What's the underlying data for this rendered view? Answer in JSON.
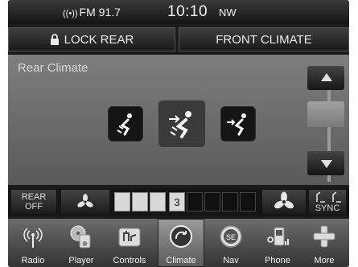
{
  "status": {
    "station": "FM 91.7",
    "time": "10:10",
    "heading": "NW"
  },
  "top_buttons": {
    "lock_rear": "LOCK REAR",
    "front_climate": "FRONT CLIMATE"
  },
  "main": {
    "title": "Rear Climate",
    "modes": [
      {
        "name": "floor",
        "icon": "airflow-floor-icon",
        "selected": false
      },
      {
        "name": "floor-panel",
        "icon": "airflow-bilevel-icon",
        "selected": true
      },
      {
        "name": "panel",
        "icon": "airflow-panel-icon",
        "selected": false
      }
    ]
  },
  "fan": {
    "rear_off_line1": "REAR",
    "rear_off_line2": "OFF",
    "level": "3",
    "sync_label": "SYNC"
  },
  "nav": [
    {
      "label": "Radio",
      "icon": "radio-icon"
    },
    {
      "label": "Player",
      "icon": "player-icon"
    },
    {
      "label": "Controls",
      "icon": "controls-icon"
    },
    {
      "label": "Climate",
      "icon": "climate-icon",
      "active": true
    },
    {
      "label": "Nav",
      "icon": "compass-icon"
    },
    {
      "label": "Phone",
      "icon": "phone-icon"
    },
    {
      "label": "More",
      "icon": "plus-icon"
    }
  ],
  "colors": {
    "background": "#1b1b1b",
    "panel": "#6e6e6e",
    "text": "#f2f2f2"
  }
}
